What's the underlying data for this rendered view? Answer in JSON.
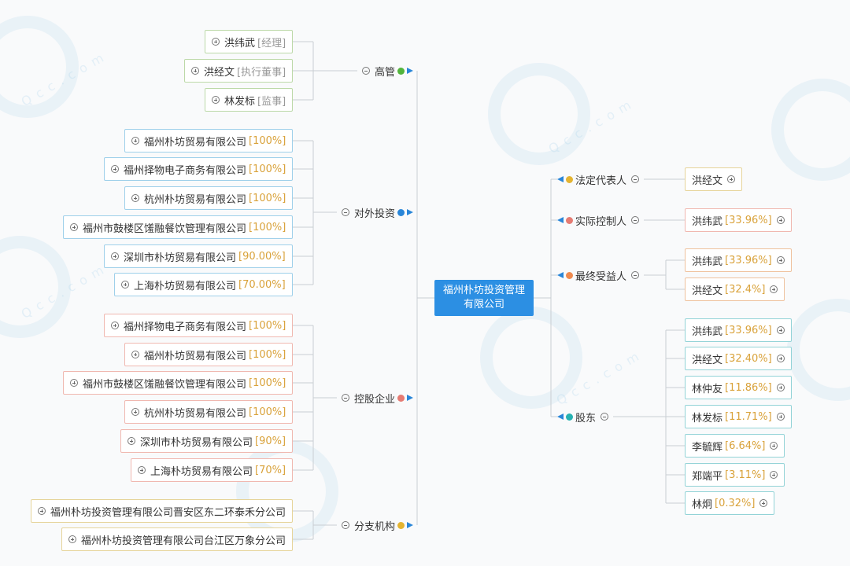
{
  "root": {
    "label": "福州朴坊投资管理有限公司"
  },
  "colors": {
    "green": "#52b43c",
    "blue": "#2a86d8",
    "red": "#e57b73",
    "gold": "#e4b431",
    "orange": "#ef8a4f",
    "teal": "#27b2b2",
    "line": "#c9ced3"
  },
  "watermark": {
    "brand_text": "Qcc.com"
  },
  "left_groups": [
    {
      "label": "高管",
      "color": "green",
      "items": [
        {
          "name": "洪纬武",
          "role": "[经理]"
        },
        {
          "name": "洪经文",
          "role": "[执行董事]"
        },
        {
          "name": "林发标",
          "role": "[监事]"
        }
      ]
    },
    {
      "label": "对外投资",
      "color": "blue",
      "items": [
        {
          "name": "福州朴坊贸易有限公司",
          "pct": "[100%]"
        },
        {
          "name": "福州择物电子商务有限公司",
          "pct": "[100%]"
        },
        {
          "name": "杭州朴坊贸易有限公司",
          "pct": "[100%]"
        },
        {
          "name": "福州市鼓楼区馐融餐饮管理有限公司",
          "pct": "[100%]"
        },
        {
          "name": "深圳市朴坊贸易有限公司",
          "pct": "[90.00%]"
        },
        {
          "name": "上海朴坊贸易有限公司",
          "pct": "[70.00%]"
        }
      ]
    },
    {
      "label": "控股企业",
      "color": "red",
      "items": [
        {
          "name": "福州择物电子商务有限公司",
          "pct": "[100%]"
        },
        {
          "name": "福州朴坊贸易有限公司",
          "pct": "[100%]"
        },
        {
          "name": "福州市鼓楼区馐融餐饮管理有限公司",
          "pct": "[100%]"
        },
        {
          "name": "杭州朴坊贸易有限公司",
          "pct": "[100%]"
        },
        {
          "name": "深圳市朴坊贸易有限公司",
          "pct": "[90%]"
        },
        {
          "name": "上海朴坊贸易有限公司",
          "pct": "[70%]"
        }
      ]
    },
    {
      "label": "分支机构",
      "color": "gold",
      "items": [
        {
          "name": "福州朴坊投资管理有限公司晋安区东二环泰禾分公司"
        },
        {
          "name": "福州朴坊投资管理有限公司台江区万象分公司"
        }
      ]
    }
  ],
  "right_groups": [
    {
      "label": "法定代表人",
      "color": "gold",
      "items": [
        {
          "name": "洪经文"
        }
      ]
    },
    {
      "label": "实际控制人",
      "color": "red",
      "items": [
        {
          "name": "洪纬武",
          "pct": "[33.96%]"
        }
      ]
    },
    {
      "label": "最终受益人",
      "color": "orange",
      "items": [
        {
          "name": "洪纬武",
          "pct": "[33.96%]"
        },
        {
          "name": "洪经文",
          "pct": "[32.4%]"
        }
      ]
    },
    {
      "label": "股东",
      "color": "teal",
      "items": [
        {
          "name": "洪纬武",
          "pct": "[33.96%]"
        },
        {
          "name": "洪经文",
          "pct": "[32.40%]"
        },
        {
          "name": "林仲友",
          "pct": "[11.86%]"
        },
        {
          "name": "林发标",
          "pct": "[11.71%]"
        },
        {
          "name": "李毓辉",
          "pct": "[6.64%]"
        },
        {
          "name": "郑端平",
          "pct": "[3.11%]"
        },
        {
          "name": "林炯",
          "pct": "[0.32%]"
        }
      ]
    }
  ]
}
